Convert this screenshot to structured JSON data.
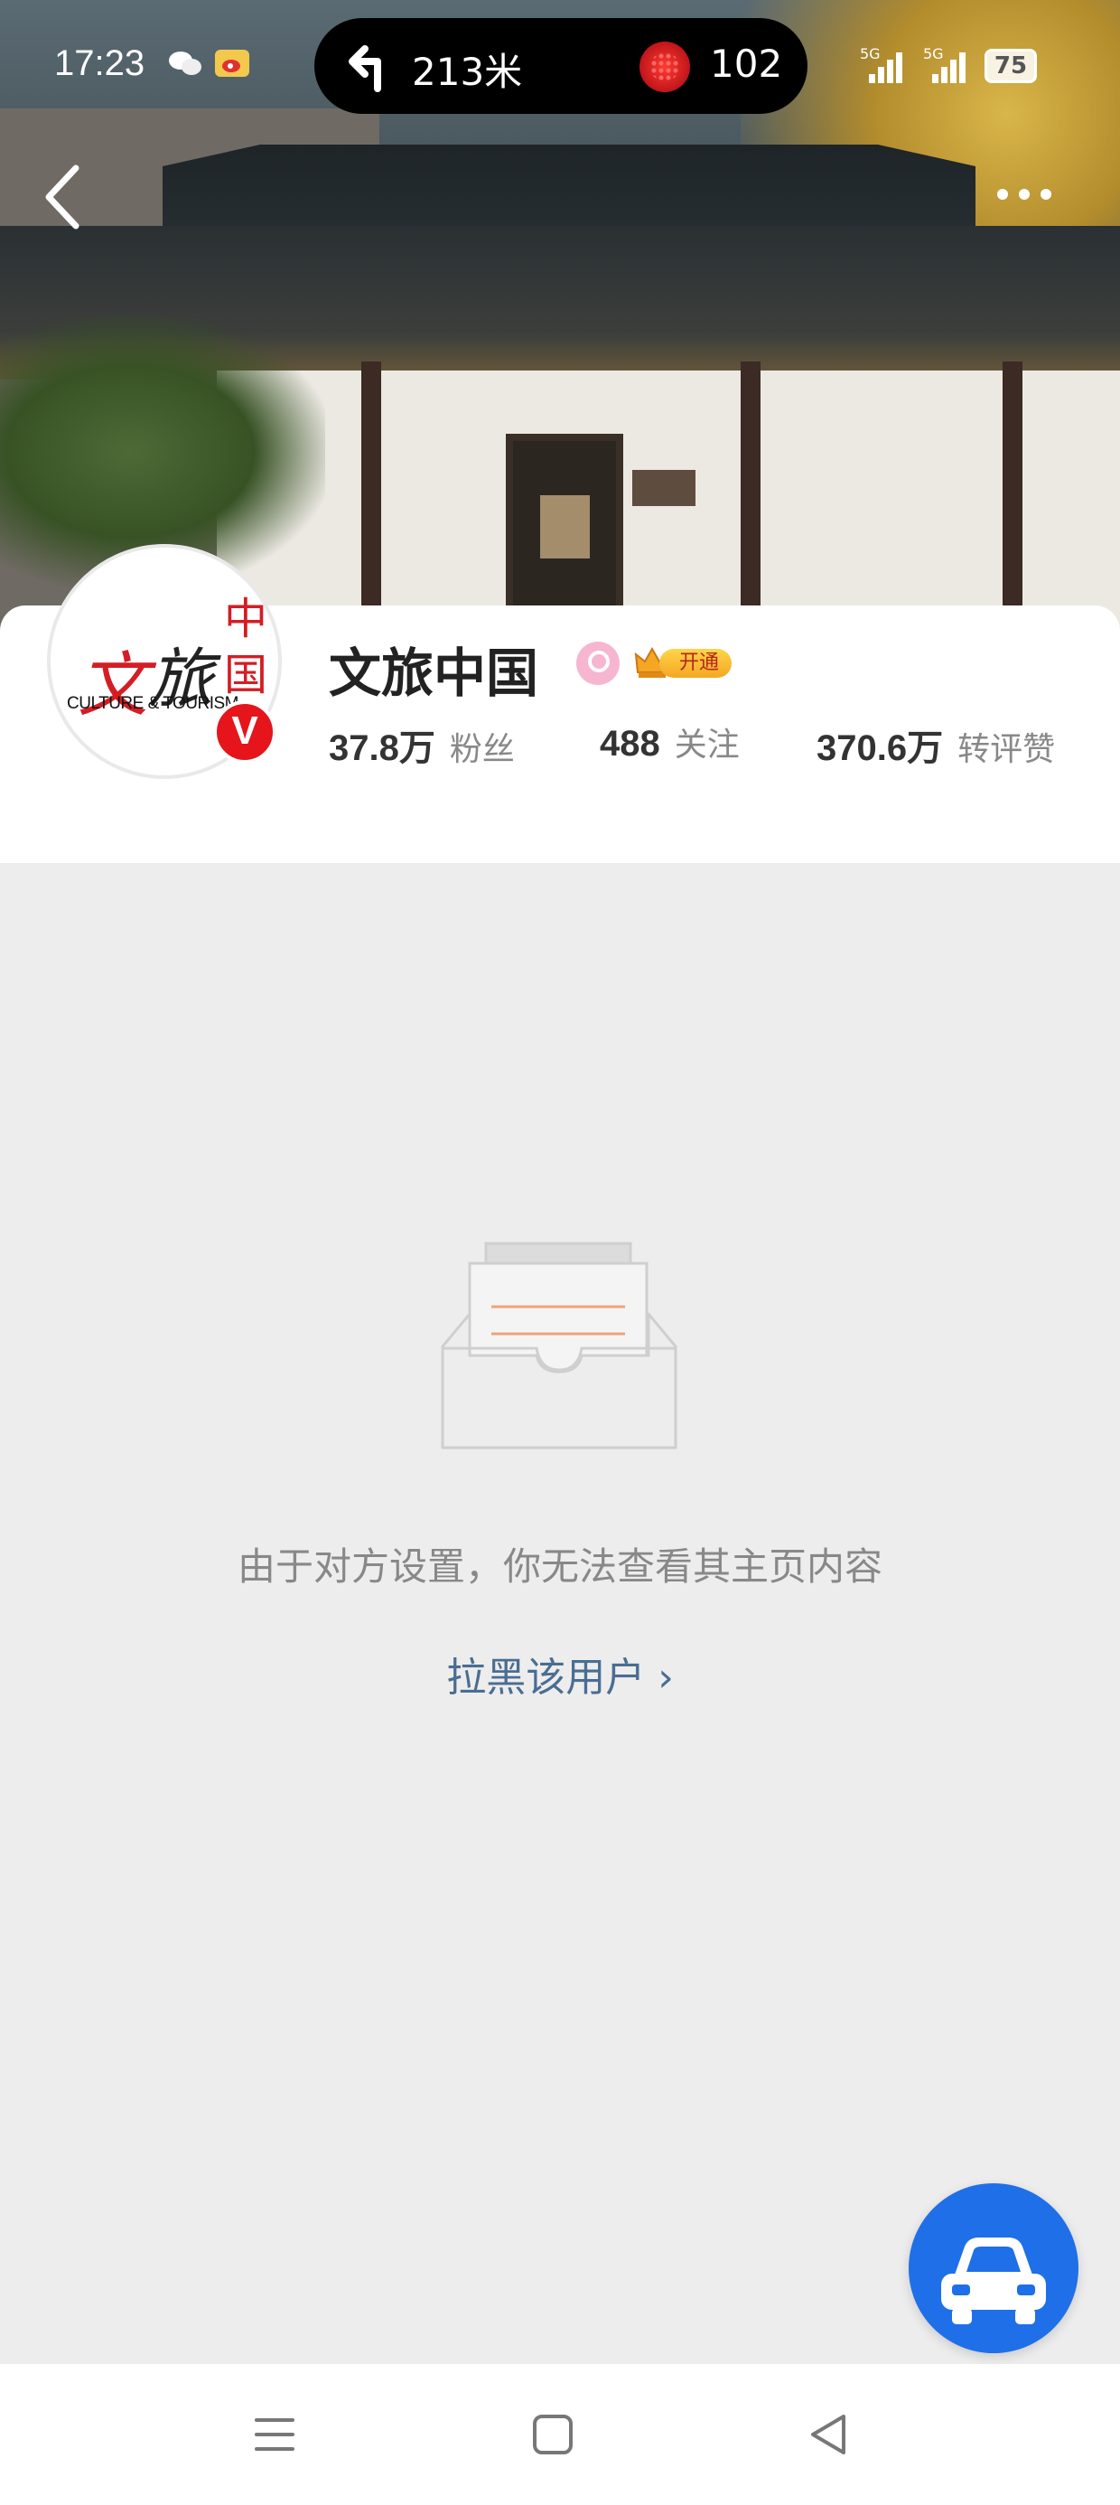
{
  "status_bar": {
    "time": "17:23",
    "nav_distance": "213米",
    "notification_count": "102",
    "signal1": "5G",
    "signal2": "5G",
    "battery": "75"
  },
  "header": {
    "back_icon": "chevron-left-icon",
    "more_icon": "more-horizontal-icon"
  },
  "profile": {
    "name": "文旅中国",
    "avatar_logo": {
      "wen": "文",
      "lv": "旅",
      "zhongguo": "中国",
      "english": "CULTURE & TOURISM"
    },
    "verified_badge": "V",
    "vip_label": "开通",
    "stats": [
      {
        "value": "37.8万",
        "label": "粉丝"
      },
      {
        "value": "488",
        "label": "关注"
      },
      {
        "value": "370.6万",
        "label": "转评赞"
      }
    ]
  },
  "empty_state": {
    "icon": "empty-inbox-icon",
    "message": "由于对方设置，你无法查看其主页内容",
    "action_link": "拉黑该用户 ›"
  },
  "floating_button": {
    "icon": "car-icon"
  },
  "nav_bar": {
    "menu_icon": "menu-icon",
    "home_icon": "home-square-icon",
    "back_icon": "back-triangle-icon"
  },
  "colors": {
    "accent_blue": "#1f6fe8",
    "link": "#4a6d92",
    "verified_red": "#e5151b",
    "background": "#ededed"
  }
}
